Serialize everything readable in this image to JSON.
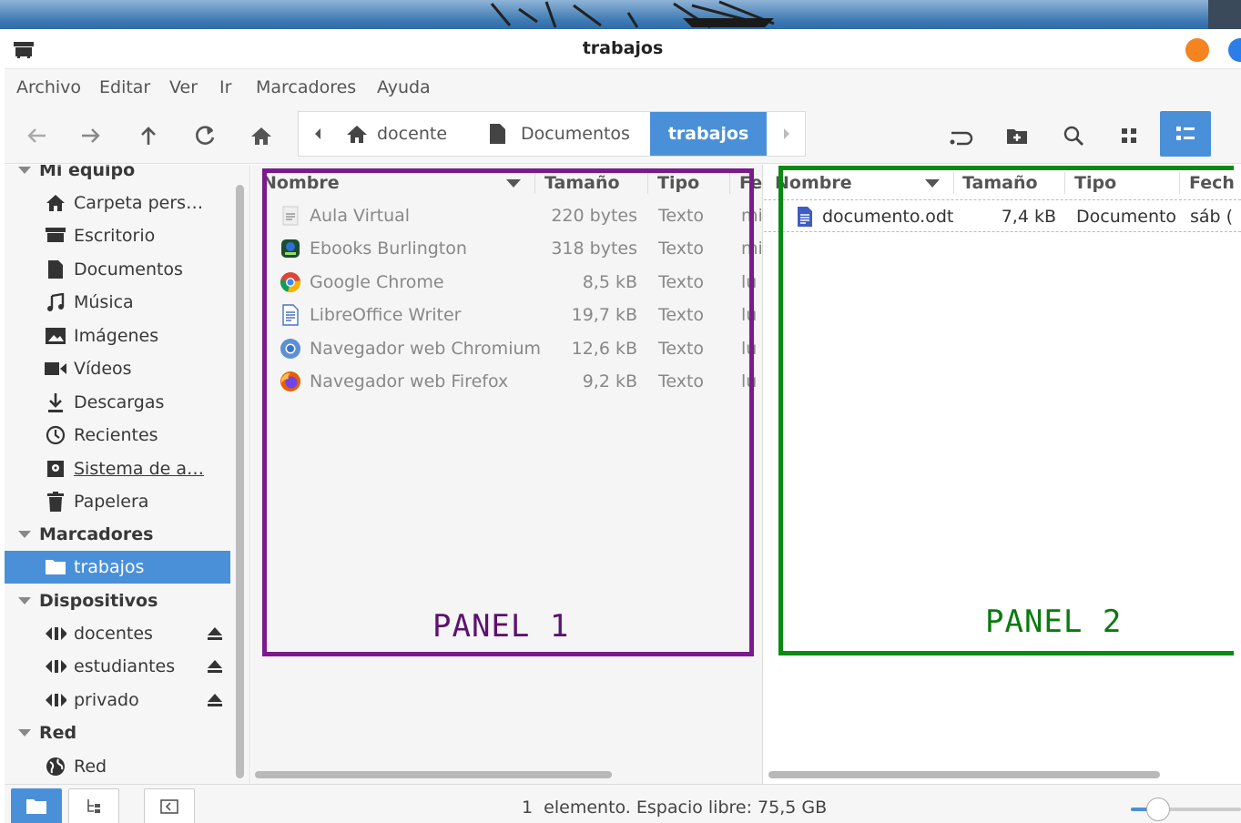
{
  "window": {
    "title": "trabajos"
  },
  "menubar": [
    "Archivo",
    "Editar",
    "Ver",
    "Ir",
    "Marcadores",
    "Ayuda"
  ],
  "pathbar": {
    "crumbs": [
      "docente",
      "Documentos",
      "trabajos"
    ]
  },
  "sidebar": {
    "sections": [
      {
        "title": "Mi equipo",
        "items": [
          {
            "label": "Carpeta pers…",
            "icon": "home-icon"
          },
          {
            "label": "Escritorio",
            "icon": "desktop-icon"
          },
          {
            "label": "Documentos",
            "icon": "document-icon"
          },
          {
            "label": "Música",
            "icon": "music-icon"
          },
          {
            "label": "Imágenes",
            "icon": "image-icon"
          },
          {
            "label": "Vídeos",
            "icon": "video-icon"
          },
          {
            "label": "Descargas",
            "icon": "download-icon"
          },
          {
            "label": "Recientes",
            "icon": "clock-icon"
          },
          {
            "label": "Sistema de a…",
            "icon": "drive-icon"
          },
          {
            "label": "Papelera",
            "icon": "trash-icon"
          }
        ]
      },
      {
        "title": "Marcadores",
        "items": [
          {
            "label": "trabajos",
            "icon": "folder-icon"
          }
        ]
      },
      {
        "title": "Dispositivos",
        "items": [
          {
            "label": "docentes",
            "icon": "network-drive-icon"
          },
          {
            "label": "estudiantes",
            "icon": "network-drive-icon"
          },
          {
            "label": "privado",
            "icon": "network-drive-icon"
          }
        ]
      },
      {
        "title": "Red",
        "items": [
          {
            "label": "Red",
            "icon": "globe-icon"
          }
        ]
      }
    ]
  },
  "panel1": {
    "columns": [
      "Nombre",
      "Tamaño",
      "Tipo",
      "Fe"
    ],
    "rows": [
      {
        "name": "Aula Virtual",
        "size": "220 bytes",
        "type": "Texto",
        "date": "mi",
        "icon": "text-file-icon"
      },
      {
        "name": "Ebooks Burlington",
        "size": "318 bytes",
        "type": "Texto",
        "date": "mi",
        "icon": "ebook-app-icon"
      },
      {
        "name": "Google Chrome",
        "size": "8,5 kB",
        "type": "Texto",
        "date": "lu",
        "icon": "chrome-icon"
      },
      {
        "name": "LibreOffice Writer",
        "size": "19,7 kB",
        "type": "Texto",
        "date": "lu",
        "icon": "writer-icon"
      },
      {
        "name": "Navegador web Chromium",
        "size": "12,6 kB",
        "type": "Texto",
        "date": "lu",
        "icon": "chromium-icon"
      },
      {
        "name": "Navegador web Firefox",
        "size": "9,2 kB",
        "type": "Texto",
        "date": "lu",
        "icon": "firefox-icon"
      }
    ],
    "annotation": "PANEL 1"
  },
  "panel2": {
    "columns": [
      "Nombre",
      "Tamaño",
      "Tipo",
      "Fech"
    ],
    "rows": [
      {
        "name": "documento.odt",
        "size": "7,4 kB",
        "type": "Documento",
        "date": "sáb (",
        "icon": "odt-document-icon"
      }
    ],
    "annotation": "PANEL 2"
  },
  "statusbar": {
    "text": "1  elemento. Espacio libre: 75,5 GB",
    "zoom": 0.15
  },
  "colors": {
    "accent": "#4a90d9",
    "panel1_box": "#7b1a8c",
    "panel2_box": "#0a8a12",
    "close": "#f5831f"
  }
}
